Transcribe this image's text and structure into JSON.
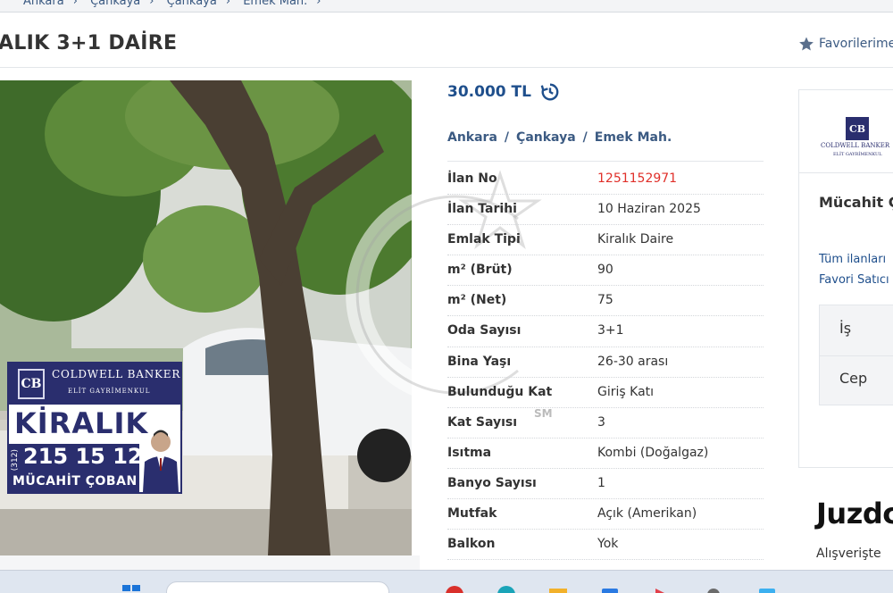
{
  "breadcrumb_top": [
    "Ankara",
    "Çankaya",
    "Çankaya",
    "Emek Mah."
  ],
  "title": "ALIK 3+1 DAİRE",
  "favorites_label": "Favorilerime",
  "price": "30.000 TL",
  "location": {
    "city": "Ankara",
    "district": "Çankaya",
    "neighborhood": "Emek Mah.",
    "sep": "/"
  },
  "specs": [
    {
      "label": "İlan No",
      "value": "1251152971"
    },
    {
      "label": "İlan Tarihi",
      "value": "10 Haziran 2025"
    },
    {
      "label": "Emlak Tipi",
      "value": "Kiralık Daire"
    },
    {
      "label": "m² (Brüt)",
      "value": "90"
    },
    {
      "label": "m² (Net)",
      "value": "75"
    },
    {
      "label": "Oda Sayısı",
      "value": "3+1"
    },
    {
      "label": "Bina Yaşı",
      "value": "26-30 arası"
    },
    {
      "label": "Bulunduğu Kat",
      "value": "Giriş Katı"
    },
    {
      "label": "Kat Sayısı",
      "value": "3"
    },
    {
      "label": "Isıtma",
      "value": "Kombi (Doğalgaz)"
    },
    {
      "label": "Banyo Sayısı",
      "value": "1"
    },
    {
      "label": "Mutfak",
      "value": "Açık (Amerikan)"
    },
    {
      "label": "Balkon",
      "value": "Yok"
    }
  ],
  "banner": {
    "logo": "CB",
    "brand": "COLDWELL BANKER",
    "sub": "ELİT GAYRİMENKUL",
    "headline": "KİRALIK",
    "area_code": "(312)",
    "phone": "215 15 12",
    "name": "MÜCAHİT ÇOBAN"
  },
  "agent": {
    "logo": "CB",
    "logo_line1": "COLDWELL BANKER",
    "logo_line2": "ELİT GAYRİMENKUL",
    "name": "Mücahit Ç",
    "all_listings": "Tüm ilanları",
    "favorite_seller": "Favori Satıcı",
    "phone_work": "İş",
    "phone_mobile": "Cep"
  },
  "ad": {
    "brand": "Juzdc",
    "tagline": "Alışverişte"
  },
  "watermark": "SM",
  "colors": {
    "link": "#1f4f8c",
    "red": "#e0302a",
    "banner_navy": "#2a2e6e"
  }
}
